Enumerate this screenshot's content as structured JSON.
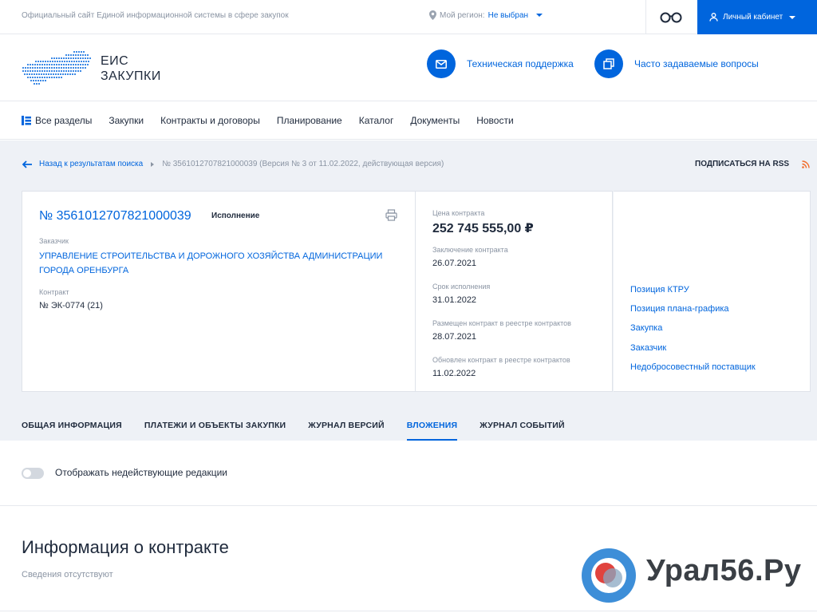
{
  "topbar": {
    "site_name": "Официальный сайт Единой информационной системы в сфере закупок",
    "region_label": "Мой регион:",
    "region_value": "Не выбран",
    "cabinet_label": "Личный кабинет"
  },
  "header": {
    "logo_line1": "ЕИС",
    "logo_line2": "ЗАКУПКИ",
    "support_label": "Техническая поддержка",
    "faq_label": "Часто задаваемые вопросы"
  },
  "nav": {
    "items": [
      "Все разделы",
      "Закупки",
      "Контракты и договоры",
      "Планирование",
      "Каталог",
      "Документы",
      "Новости"
    ]
  },
  "breadcrumb": {
    "back": "Назад к результатам поиска",
    "current": "№ 3561012707821000039 (Версия № 3 от 11.02.2022, действующая версия)"
  },
  "rss_label": "ПОДПИСАТЬСЯ НА RSS",
  "contract": {
    "number": "№ 3561012707821000039",
    "status": "Исполнение",
    "customer_label": "Заказчик",
    "customer_value": "УПРАВЛЕНИЕ СТРОИТЕЛЬСТВА И ДОРОЖНОГО ХОЗЯЙСТВА АДМИНИСТРАЦИИ ГОРОДА ОРЕНБУРГА",
    "contract_label": "Контракт",
    "contract_value": "№ ЭК-0774 (21)"
  },
  "details": {
    "price_label": "Цена контракта",
    "price_value": "252 745 555,00 ₽",
    "concluded_label": "Заключение контракта",
    "concluded_value": "26.07.2021",
    "term_label": "Срок исполнения",
    "term_value": "31.01.2022",
    "placed_label": "Размещен контракт в реестре контрактов",
    "placed_value": "28.07.2021",
    "updated_label": "Обновлен контракт в реестре контрактов",
    "updated_value": "11.02.2022"
  },
  "side_links": [
    "Позиция КТРУ",
    "Позиция плана-графика",
    "Закупка",
    "Заказчик",
    "Недобросовестный поставщик"
  ],
  "tabs": [
    "ОБЩАЯ ИНФОРМАЦИЯ",
    "ПЛАТЕЖИ И ОБЪЕКТЫ ЗАКУПКИ",
    "ЖУРНАЛ ВЕРСИЙ",
    "ВЛОЖЕНИЯ",
    "ЖУРНАЛ СОБЫТИЙ"
  ],
  "active_tab": "ВЛОЖЕНИЯ",
  "toggle_label": "Отображать недействующие редакции",
  "info_title": "Информация о контракте",
  "info_empty": "Сведения отсутствуют",
  "watermark": "Урал56.Ру",
  "colors": {
    "accent": "#0065dd",
    "background_gray": "#eef1f6",
    "text": "#1f2a3c",
    "muted": "#8a94a3"
  }
}
